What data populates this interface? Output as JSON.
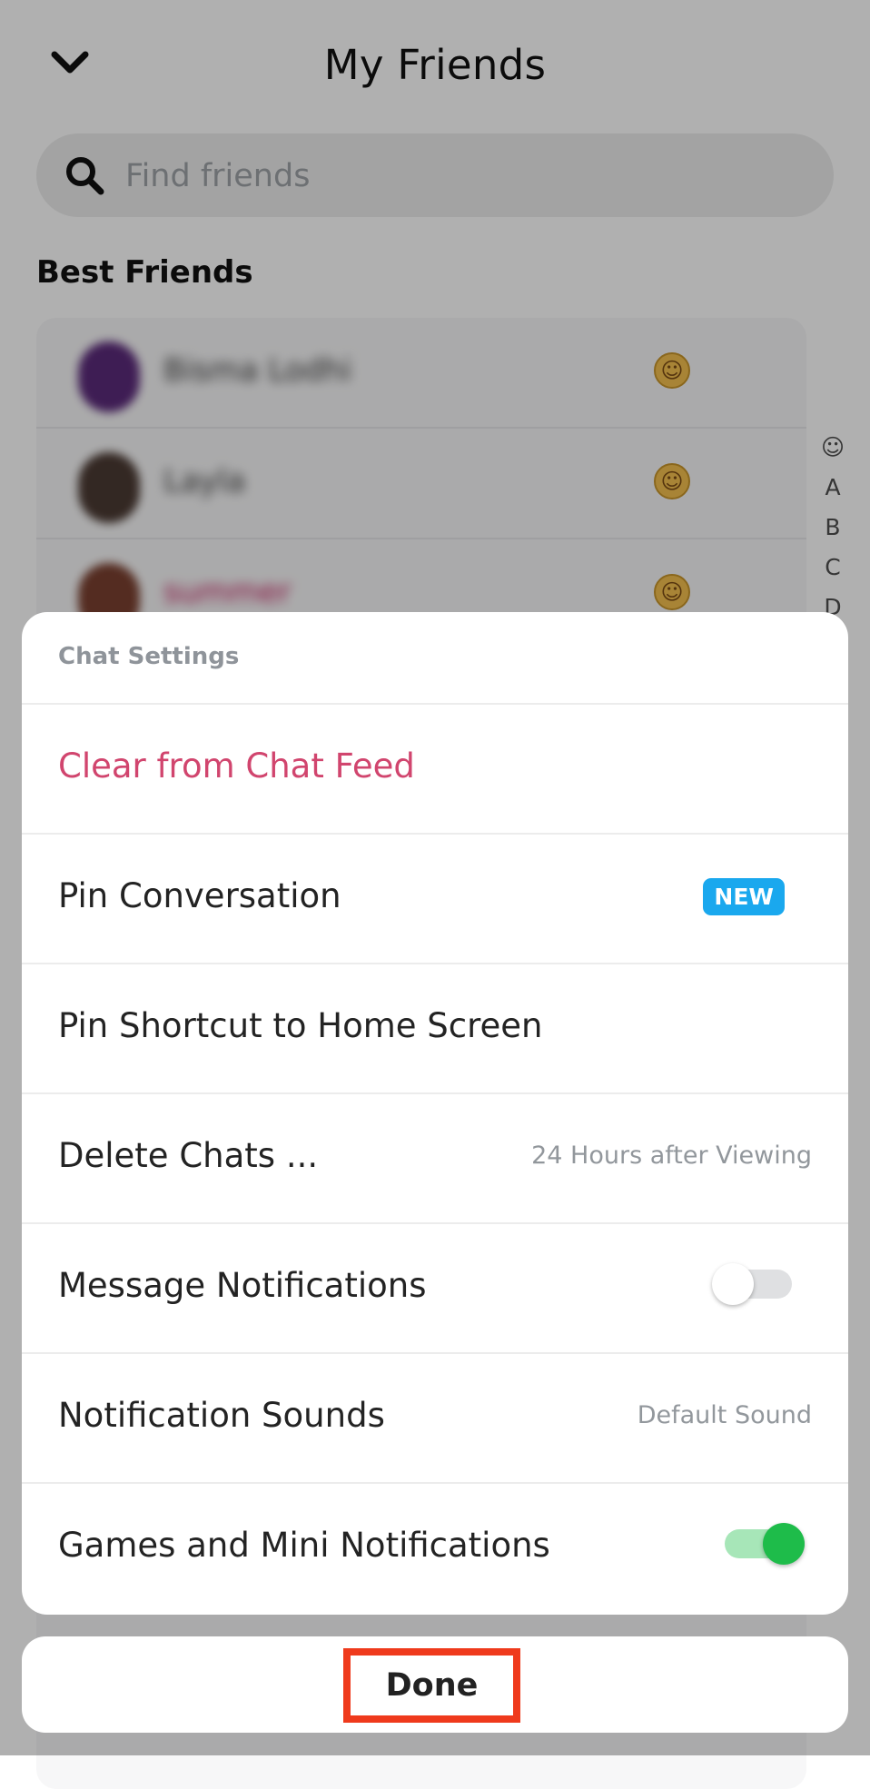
{
  "header": {
    "title": "My Friends",
    "back_icon": "chevron-down-icon"
  },
  "search": {
    "placeholder": "Find friends",
    "icon": "search-icon"
  },
  "best_friends": {
    "title": "Best Friends",
    "friends": [
      {
        "name": "Bisma Lodhi",
        "emoji": "☺"
      },
      {
        "name": "Layla",
        "emoji": "☺"
      },
      {
        "name": "summer",
        "emoji": "☺"
      }
    ]
  },
  "alpha_index": [
    "☺",
    "A",
    "B",
    "C",
    "D"
  ],
  "sheet": {
    "title": "Chat Settings",
    "items": [
      {
        "label": "Clear from Chat Feed",
        "danger": true
      },
      {
        "label": "Pin Conversation",
        "badge": "NEW"
      },
      {
        "label": "Pin Shortcut to Home Screen"
      },
      {
        "label": "Delete Chats ...",
        "value": "24 Hours after Viewing"
      },
      {
        "label": "Message Notifications",
        "toggle": false
      },
      {
        "label": "Notification Sounds",
        "value": "Default Sound"
      },
      {
        "label": "Games and Mini Notifications",
        "toggle": true
      }
    ]
  },
  "done": {
    "label": "Done"
  },
  "colors": {
    "danger": "#d1456e",
    "badge": "#1aa8ee",
    "toggle_on": "#1ebc4a",
    "highlight_border": "#ef3a1c"
  }
}
